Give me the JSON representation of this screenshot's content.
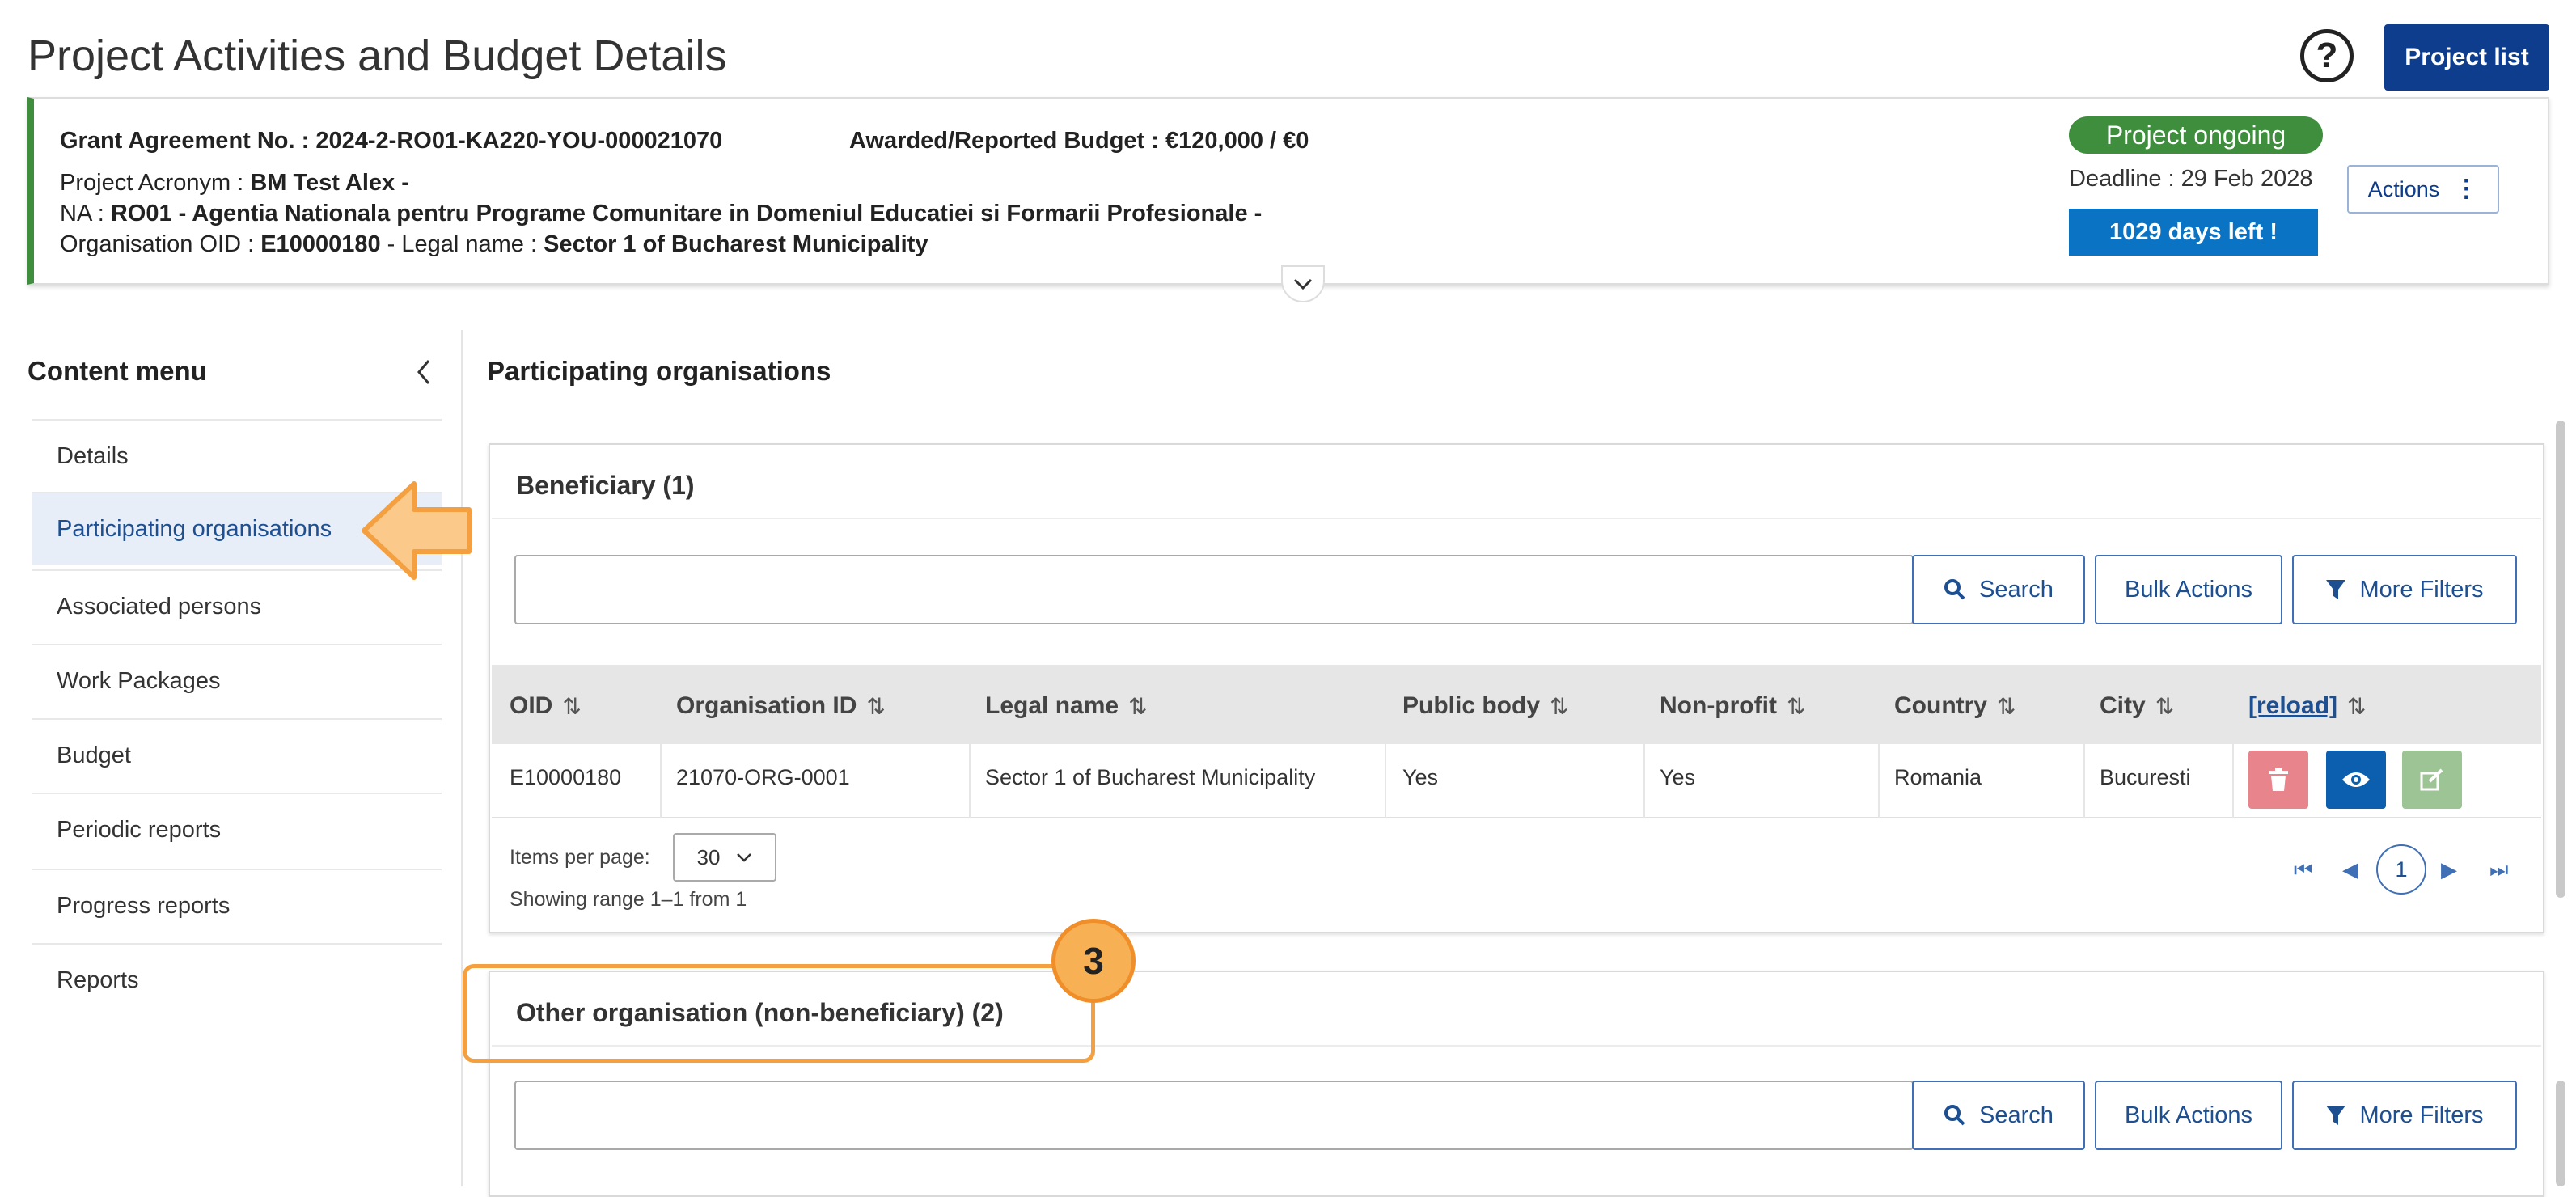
{
  "header": {
    "title": "Project Activities and Budget Details",
    "help_icon": "question-circle-icon",
    "project_list_label": "Project list"
  },
  "project": {
    "grant_label": "Grant Agreement No. : ",
    "grant_value": "2024-2-RO01-KA220-YOU-000021070",
    "budget_label": "Awarded/Reported Budget : ",
    "budget_value": "€120,000 / €0",
    "acronym_label": "Project Acronym : ",
    "acronym_value": "BM Test Alex -",
    "na_label": "NA : ",
    "na_value": "RO01 - Agentia Nationala pentru Programe Comunitare in Domeniul Educatiei si Formarii Profesionale -",
    "oid_label": "Organisation OID : ",
    "oid_value": "E10000180",
    "legal_label": " - Legal name : ",
    "legal_value": "Sector 1 of Bucharest Municipality",
    "status": "Project ongoing",
    "status_color": "#3e8e3e",
    "deadline": "Deadline : 29 Feb 2028",
    "days_left": "1029 days left !",
    "actions_label": "Actions"
  },
  "sidebar": {
    "title": "Content menu",
    "items": [
      {
        "label": "Details"
      },
      {
        "label": "Participating organisations",
        "active": true
      },
      {
        "label": "Associated persons"
      },
      {
        "label": "Work Packages"
      },
      {
        "label": "Budget"
      },
      {
        "label": "Periodic reports"
      },
      {
        "label": "Progress reports"
      },
      {
        "label": "Reports"
      }
    ]
  },
  "main": {
    "section_title": "Participating organisations",
    "beneficiary": {
      "title": "Beneficiary (1)",
      "search_label": "Search",
      "bulk_label": "Bulk Actions",
      "filters_label": "More Filters",
      "columns": [
        "OID",
        "Organisation ID",
        "Legal name",
        "Public body",
        "Non-profit",
        "Country",
        "City",
        "[reload]"
      ],
      "rows": [
        {
          "oid": "E10000180",
          "org_id": "21070-ORG-0001",
          "legal_name": "Sector 1 of Bucharest Municipality",
          "public_body": "Yes",
          "non_profit": "Yes",
          "country": "Romania",
          "city": "Bucuresti"
        }
      ],
      "items_per_page_label": "Items per page:",
      "items_per_page_value": "30",
      "range_text": "Showing range 1–1 from 1",
      "current_page": "1"
    },
    "other": {
      "title": "Other organisation (non-beneficiary) (2)",
      "search_label": "Search",
      "bulk_label": "Bulk Actions",
      "filters_label": "More Filters"
    }
  },
  "annotations": {
    "step_number": "3",
    "accent_color": "#f5a040"
  }
}
